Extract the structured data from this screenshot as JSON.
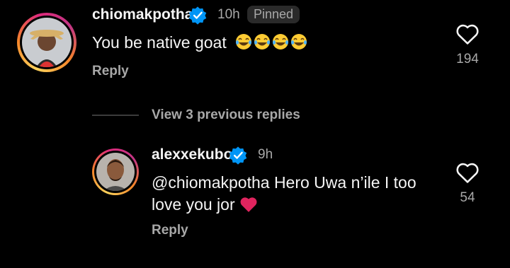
{
  "comments": [
    {
      "username": "chiomakpotha",
      "time": "10h",
      "badge": "Pinned",
      "text": "You be native goat",
      "emoji_count": 4,
      "reply_label": "Reply",
      "likes": "194"
    },
    {
      "username": "alexxekubo",
      "time": "9h",
      "text_line1": "@chiomakpotha Hero Uwa n’ile I too",
      "text_line2": "love you jor",
      "reply_label": "Reply",
      "likes": "54"
    }
  ],
  "view_previous_label": "View 3 previous replies",
  "icons": {
    "verified": "verified-badge-icon",
    "like": "heart-outline-icon",
    "emoji": "tears-of-joy-emoji",
    "red_heart": "red-heart-emoji"
  },
  "colors": {
    "background": "#000000",
    "text_primary": "#f5f5f5",
    "text_secondary": "#a8a8a8",
    "verified_blue": "#0095f6",
    "pinned_bg": "#2a2a2a",
    "heart_red": "#e0245e"
  }
}
